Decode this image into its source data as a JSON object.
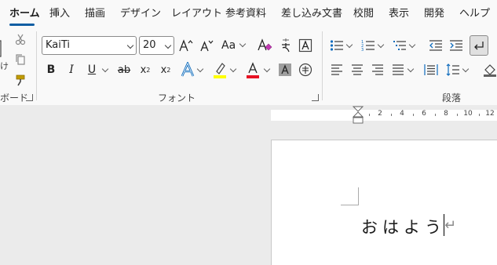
{
  "tabs": [
    "ホーム",
    "挿入",
    "描画",
    "デザイン",
    "レイアウト",
    "参考資料",
    "差し込み文書",
    "校閲",
    "表示",
    "開発",
    "ヘルプ"
  ],
  "active_tab": "ホーム",
  "clipboard": {
    "paste_label_fragment": "け",
    "group_label_fragment": "ボード"
  },
  "font": {
    "font_name": "KaiTi",
    "font_size": "20",
    "group_label": "フォント",
    "change_case_label": "Aa",
    "font_color": "#e81123",
    "highlight_color": "#ffff00"
  },
  "paragraph": {
    "group_label": "段落"
  },
  "ruler": {
    "numbers": [
      "2",
      "4",
      "6",
      "8",
      "10",
      "12"
    ]
  },
  "document": {
    "text": "おはよう"
  },
  "colors": {
    "accent": "#115ea3",
    "tab_bar": "#f9f9f9",
    "workspace": "#ebebeb",
    "page": "#ffffff"
  }
}
